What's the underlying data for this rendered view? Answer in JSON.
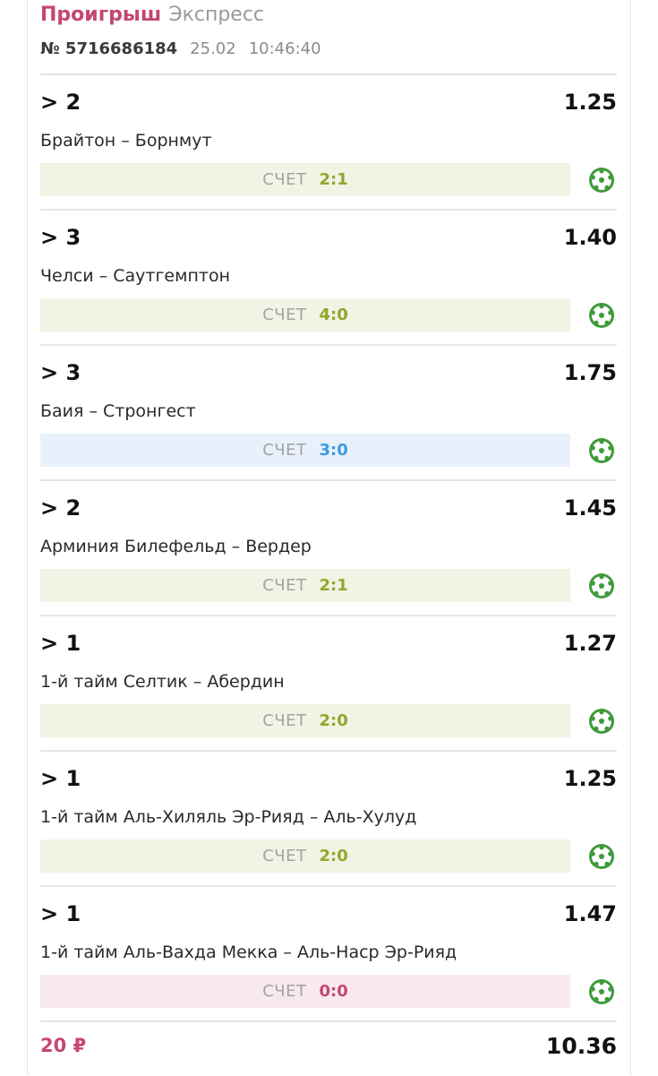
{
  "header": {
    "status": "Проигрыш",
    "bet_type": "Экспресс",
    "number": "№ 5716686184",
    "date": "25.02",
    "time": "10:46:40"
  },
  "score_label": "СЧЕТ",
  "colors": {
    "lost": "#c4476e",
    "win_score": "#8fa82c",
    "pending_score": "#3d9be0",
    "ball": "#3f9a3a"
  },
  "bets": [
    {
      "outcome": "> 2",
      "odds": "1.25",
      "event": "Брайтон – Борнмут",
      "score": "2:1",
      "state": "win"
    },
    {
      "outcome": "> 3",
      "odds": "1.40",
      "event": "Челси – Саутгемптон",
      "score": "4:0",
      "state": "win"
    },
    {
      "outcome": "> 3",
      "odds": "1.75",
      "event": "Баия – Стронгест",
      "score": "3:0",
      "state": "pending"
    },
    {
      "outcome": "> 2",
      "odds": "1.45",
      "event": "Арминия Билефельд – Вердер",
      "score": "2:1",
      "state": "win"
    },
    {
      "outcome": "> 1",
      "odds": "1.27",
      "event": "1-й тайм Селтик – Абердин",
      "score": "2:0",
      "state": "win"
    },
    {
      "outcome": "> 1",
      "odds": "1.25",
      "event": "1-й тайм Аль-Хиляль Эр-Рияд – Аль-Хулуд",
      "score": "2:0",
      "state": "win"
    },
    {
      "outcome": "> 1",
      "odds": "1.47",
      "event": "1-й тайм Аль-Вахда Мекка – Аль-Наср Эр-Рияд",
      "score": "0:0",
      "state": "lose"
    }
  ],
  "footer": {
    "stake": "20 ₽",
    "total_odds": "10.36"
  }
}
